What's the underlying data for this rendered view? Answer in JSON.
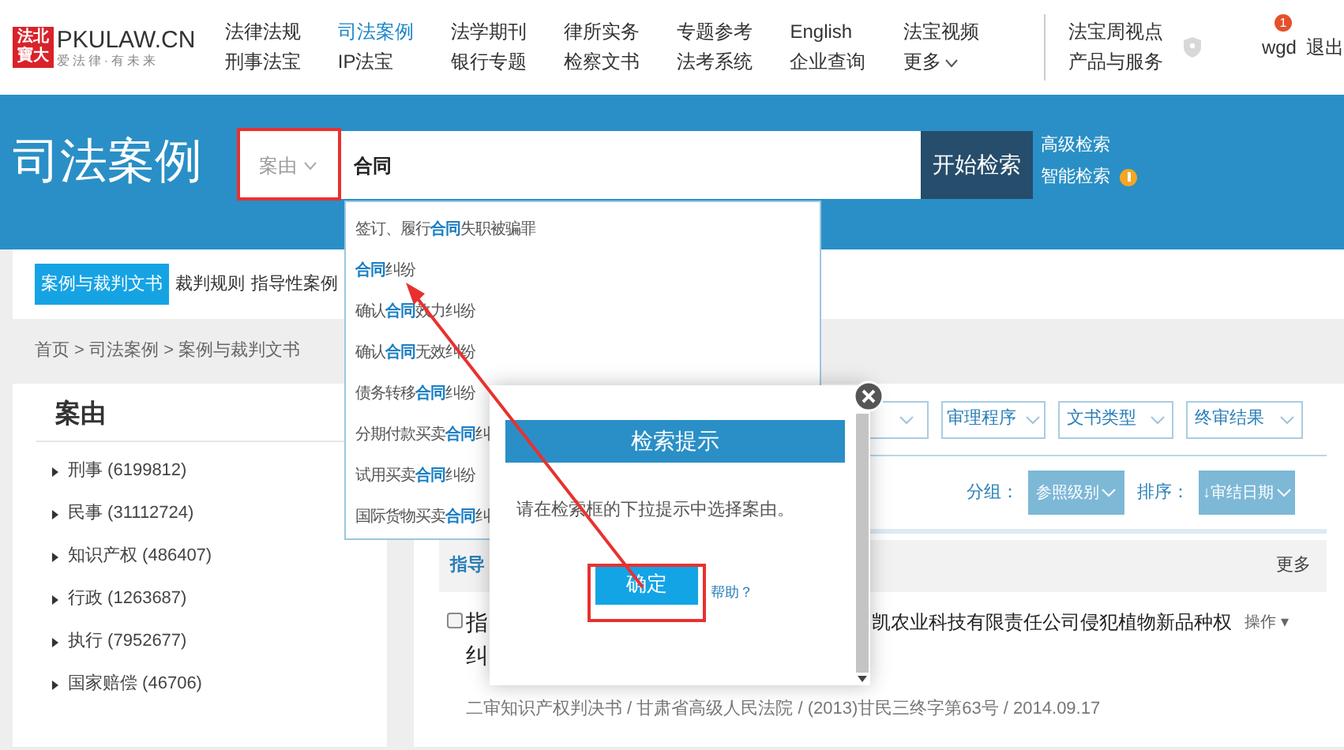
{
  "logo": {
    "mark_top": "法北",
    "mark_bottom": "寶大",
    "name": "PKULAW.CN",
    "slogan": "爱法律·有未来"
  },
  "nav": [
    {
      "items": [
        {
          "label": "法律法规",
          "selected": false,
          "caret": false
        },
        {
          "label": "刑事法宝",
          "selected": false,
          "caret": false
        }
      ]
    },
    {
      "items": [
        {
          "label": "司法案例",
          "selected": true,
          "caret": false
        },
        {
          "label": "IP法宝",
          "selected": false,
          "caret": false
        }
      ]
    },
    {
      "items": [
        {
          "label": "法学期刊",
          "selected": false,
          "caret": false
        },
        {
          "label": "银行专题",
          "selected": false,
          "caret": false
        }
      ]
    },
    {
      "items": [
        {
          "label": "律所实务",
          "selected": false,
          "caret": false
        },
        {
          "label": "检察文书",
          "selected": false,
          "caret": false
        }
      ]
    },
    {
      "items": [
        {
          "label": "专题参考",
          "selected": false,
          "caret": false
        },
        {
          "label": "法考系统",
          "selected": false,
          "caret": false
        }
      ]
    },
    {
      "items": [
        {
          "label": "English",
          "selected": false,
          "caret": false
        },
        {
          "label": "企业查询",
          "selected": false,
          "caret": false
        }
      ]
    },
    {
      "items": [
        {
          "label": "法宝视频",
          "selected": false,
          "caret": false
        },
        {
          "label": "更多",
          "selected": false,
          "caret": true
        }
      ]
    }
  ],
  "nav_extra": [
    "法宝周视点",
    "产品与服务"
  ],
  "user": {
    "name": "wgd",
    "badge": "1",
    "logout": "退出"
  },
  "banner": {
    "title": "司法案例",
    "search_field": "案由",
    "search_value": "合同",
    "search_button": "开始检索",
    "links": [
      "高级检索",
      "智能检索"
    ]
  },
  "suggestions": [
    "签订、履行**合同**失职被骗罪",
    "**合同**纠纷",
    "确认**合同**效力纠纷",
    "确认**合同**无效纠纷",
    "债务转移**合同**纠纷",
    "分期付款买卖**合同**纠",
    "试用买卖**合同**纠纷",
    "国际货物买卖**合同**纠"
  ],
  "tabs": [
    {
      "label": "案例与裁判文书",
      "selected": true
    },
    {
      "label": "裁判规则",
      "selected": false
    },
    {
      "label": "指导性案例",
      "selected": false
    }
  ],
  "breadcrumb": "首页 > 司法案例 > 案例与裁判文书",
  "categories": {
    "title": "案由",
    "items": [
      "刑事 (6199812)",
      "民事 (31112724)",
      "知识产权 (486407)",
      "行政 (1263687)",
      "执行 (7952677)",
      "国家赔偿 (46706)"
    ]
  },
  "filters": [
    "审理程序",
    "文书类型",
    "终审结果"
  ],
  "grouping": {
    "group_label": "分组：",
    "group_value": "参照级别",
    "sort_label": "排序：",
    "sort_value": "↓审结日期"
  },
  "section": {
    "title": "指导",
    "more": "更多"
  },
  "result": {
    "checked": false,
    "title_left": "指",
    "title_right": "凯农业科技有限责任公司侵犯植物新品种权",
    "title_line2": "纠",
    "action": "操作 ▾",
    "meta": "二审知识产权判决书 / 甘肃省高级人民法院 / (2013)甘民三终字第63号 / 2014.09.17"
  },
  "dialog": {
    "title": "检索提示",
    "message": "请在检索框的下拉提示中选择案由。",
    "ok": "确定",
    "help": "帮助？"
  }
}
